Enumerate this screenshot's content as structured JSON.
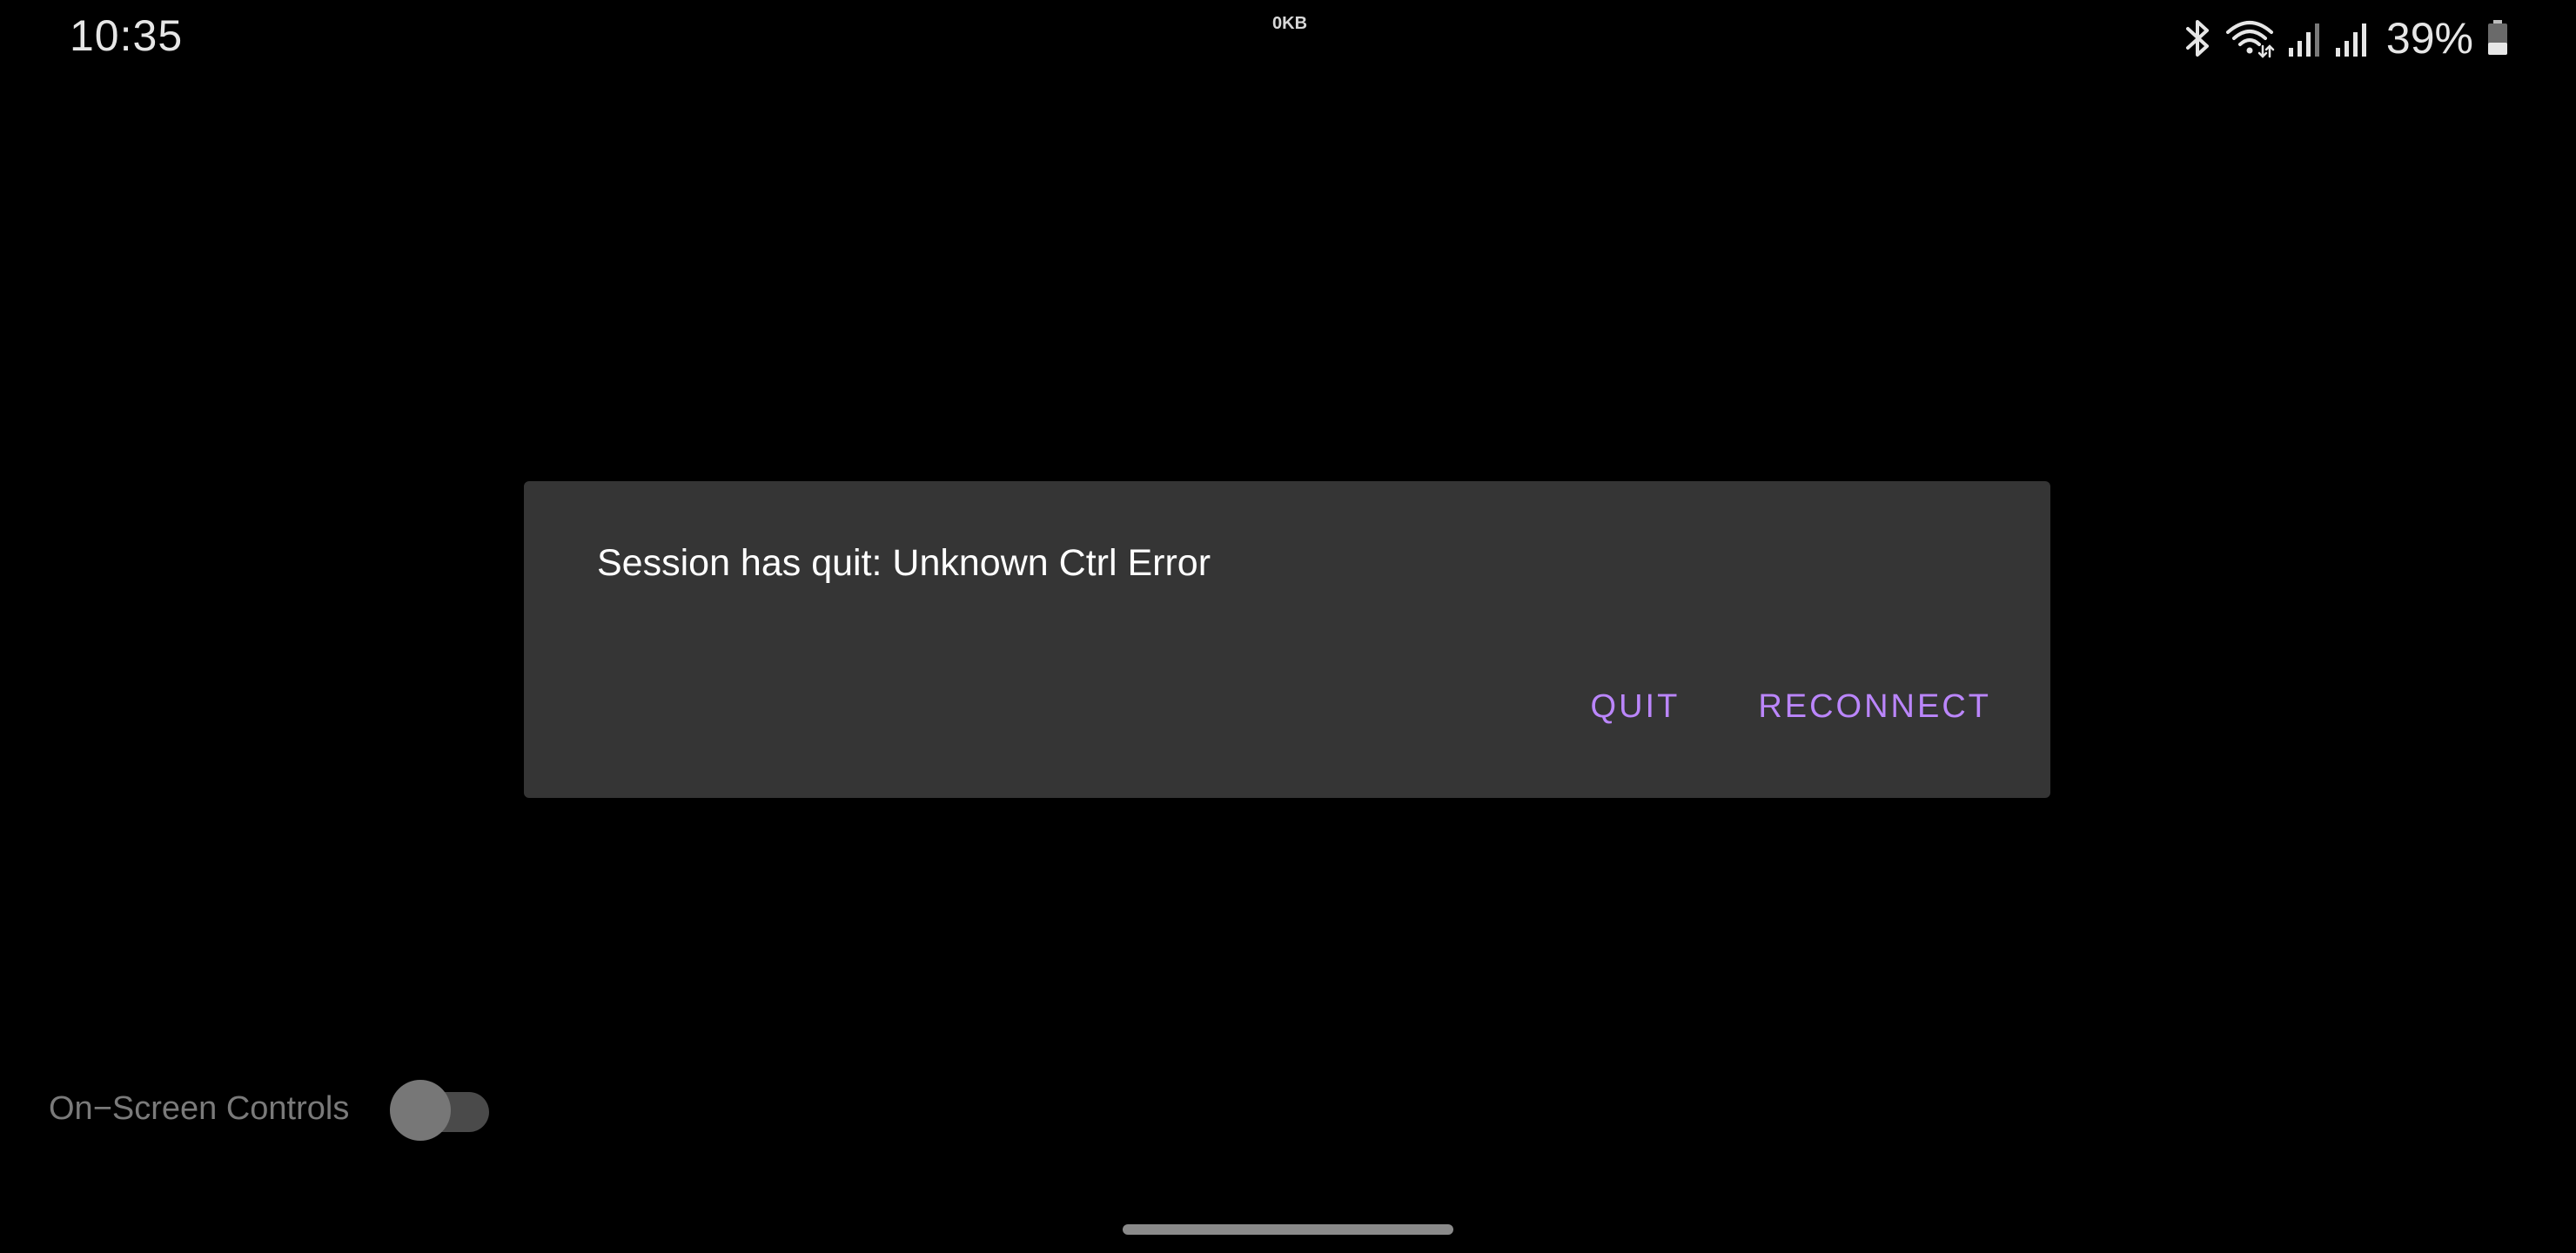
{
  "status_bar": {
    "time": "10:35",
    "net_speed": "0KB",
    "battery_percent": "39%",
    "battery_level": 0.39,
    "icons": [
      "bluetooth-icon",
      "wifi-icon",
      "signal-icon",
      "signal-icon",
      "battery-icon"
    ]
  },
  "dialog": {
    "message": "Session has quit: Unknown Ctrl Error",
    "quit_label": "QUIT",
    "reconnect_label": "RECONNECT"
  },
  "controls": {
    "on_screen_controls_label": "On−Screen Controls",
    "on_screen_controls_enabled": false
  },
  "colors": {
    "background": "#000000",
    "dialog_bg": "#353535",
    "accent": "#bb86fc",
    "dialog_text": "#ffffff"
  }
}
